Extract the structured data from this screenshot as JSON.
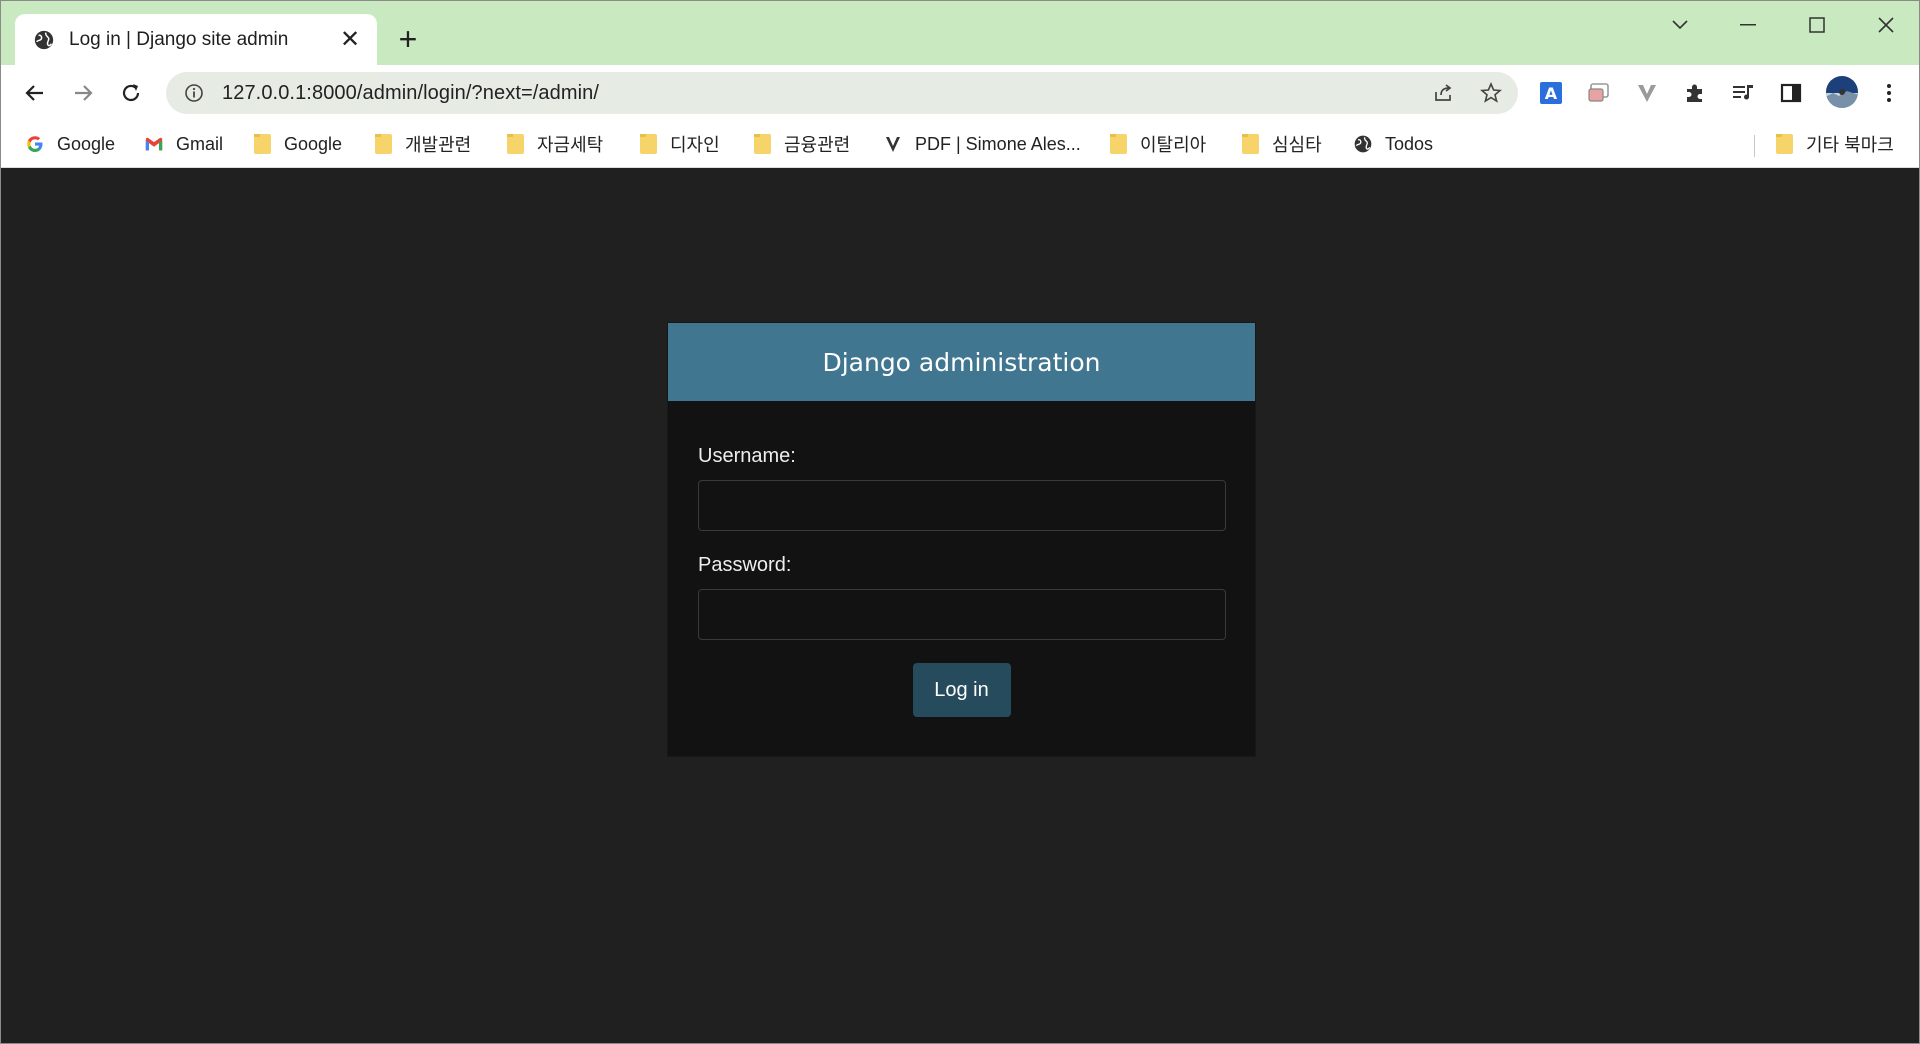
{
  "browser": {
    "tab": {
      "title": "Log in | Django site admin",
      "close": "✕"
    },
    "new_tab": "+",
    "address_bar": {
      "url": "127.0.0.1:8000/admin/login/?next=/admin/"
    },
    "bookmarks": [
      {
        "label": "Google",
        "icon": "google-icon"
      },
      {
        "label": "Gmail",
        "icon": "gmail-icon"
      },
      {
        "label": "Google",
        "icon": "folder-icon"
      },
      {
        "label": "개발관련",
        "icon": "folder-icon"
      },
      {
        "label": "자금세탁",
        "icon": "folder-icon"
      },
      {
        "label": "디자인",
        "icon": "folder-icon"
      },
      {
        "label": "금융관련",
        "icon": "folder-icon"
      },
      {
        "label": "PDF | Simone Ales...",
        "icon": "v-icon"
      },
      {
        "label": "이탈리아",
        "icon": "folder-icon"
      },
      {
        "label": "심심타",
        "icon": "folder-icon"
      },
      {
        "label": "Todos",
        "icon": "globe-icon"
      }
    ],
    "other_bookmarks": "기타 북마크"
  },
  "page": {
    "header": "Django administration",
    "username_label": "Username:",
    "password_label": "Password:",
    "submit_label": "Log in"
  },
  "colors": {
    "tabstrip": "#c9eac0",
    "page_bg": "#202020",
    "login_header": "#417690",
    "button": "#264b5d"
  }
}
